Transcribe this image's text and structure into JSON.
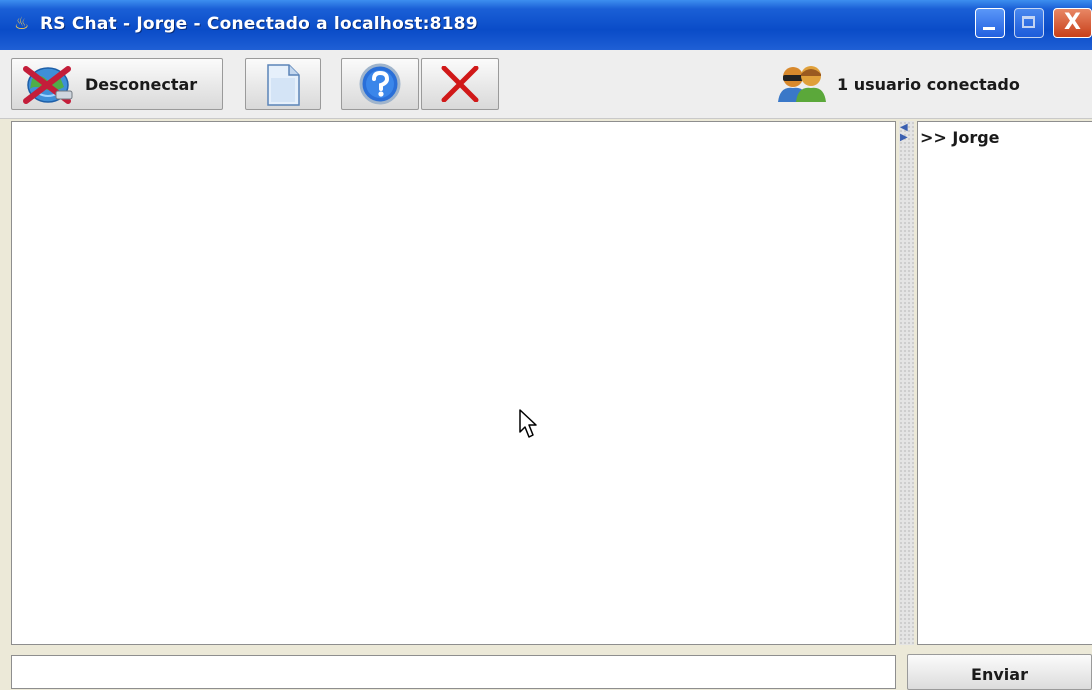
{
  "window": {
    "title": "RS Chat - Jorge - Conectado a localhost:8189",
    "app_icon": "java-coffee-icon",
    "controls": [
      "minimize-icon",
      "maximize-icon",
      "close-icon"
    ],
    "close_glyph": "X"
  },
  "toolbar": {
    "disconnect_label": "Desconectar",
    "disconnect_icon": "disconnect-globe-icon",
    "new_icon": "new-document-icon",
    "help_icon": "help-question-icon",
    "clear_icon": "red-x-icon"
  },
  "status": {
    "users_connected": "1 usuario conectado",
    "users_icon": "users-icon"
  },
  "users": {
    "items": [
      ">> Jorge"
    ]
  },
  "chat": {
    "send_label": "Enviar",
    "message_value": "",
    "history": ""
  },
  "colors": {
    "titlebar": "#0a4cc8",
    "close_button": "#c8401a",
    "help_blue": "#2a6fd8",
    "clear_red": "#d01818"
  }
}
